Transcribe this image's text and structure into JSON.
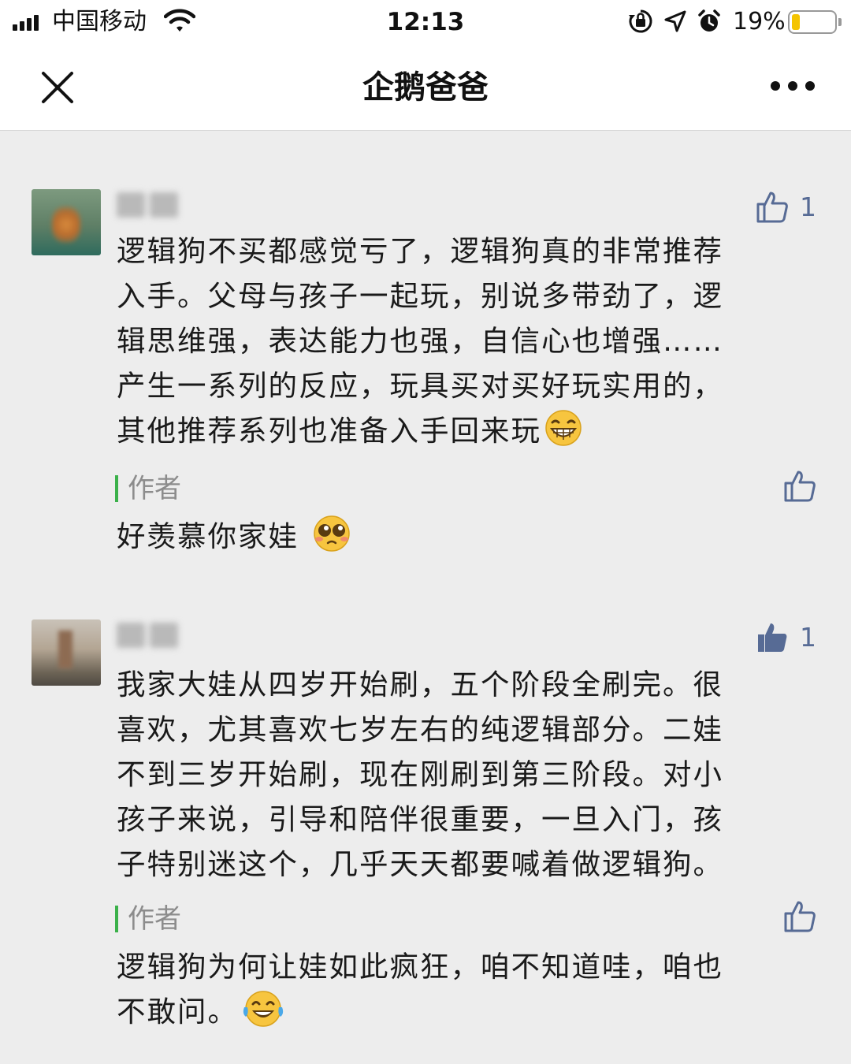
{
  "status_bar": {
    "carrier": "中国移动",
    "time": "12:13",
    "battery_percent": "19%",
    "battery_level": 0.19,
    "battery_color": "#f4c400"
  },
  "nav": {
    "title": "企鹅爸爸",
    "close_icon": "close-icon",
    "more_icon": "more-icon"
  },
  "comments": [
    {
      "likes": "1",
      "liked": false,
      "lines": [
        "逻辑狗不买都感觉亏了，逻辑狗真的非常推荐",
        "入手。父母与孩子一起玩，别说多带劲了，逻",
        "辑思维强，表达能力也强，自信心也增强……",
        "产生一系列的反应，玩具买对买好玩实用的，",
        "其他推荐系列也准备入手回来玩"
      ],
      "emoji": "grin-emoji",
      "reply": {
        "author_label": "作者",
        "lines": [
          "好羡慕你家娃"
        ],
        "emoji": "pleading-emoji"
      }
    },
    {
      "likes": "1",
      "liked": true,
      "lines": [
        "我家大娃从四岁开始刷，五个阶段全刷完。很",
        "喜欢，尤其喜欢七岁左右的纯逻辑部分。二娃",
        "不到三岁开始刷，现在刚刷到第三阶段。对小",
        "孩子来说，引导和陪伴很重要，一旦入门，孩",
        "子特别迷这个，几乎天天都要喊着做逻辑狗。"
      ],
      "reply": {
        "author_label": "作者",
        "lines": [
          "逻辑狗为何让娃如此疯狂，咱不知道哇，咱也",
          "不敢问。"
        ],
        "emoji": "tears-of-joy-emoji"
      }
    }
  ],
  "colors": {
    "like_blue": "#576b95",
    "author_green": "#3bb14a",
    "background": "#ededed"
  }
}
